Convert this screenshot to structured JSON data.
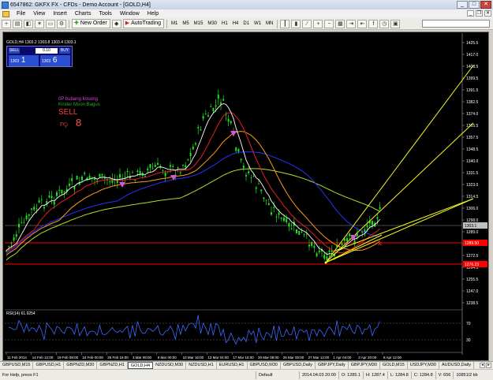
{
  "window": {
    "title": "6547862: GKFX FX - CFDs - Demo Account - [GOLD,H4]"
  },
  "menu": {
    "items": [
      "File",
      "View",
      "Insert",
      "Charts",
      "Tools",
      "Window",
      "Help"
    ]
  },
  "toolbar": {
    "new_order": "New Order",
    "auto_trading": "AutoTrading",
    "timeframes": [
      "M1",
      "M5",
      "M15",
      "M30",
      "H1",
      "H4",
      "D1",
      "W1",
      "MN"
    ]
  },
  "trade_panel": {
    "sell_label": "SELL",
    "buy_label": "BUY",
    "lot": "0.10",
    "sell_price_big": "1",
    "sell_price_small": "1303",
    "buy_price_big": "6",
    "buy_price_small": "1303"
  },
  "chart": {
    "symbol_info": "GOLD,H4  1303.2 1303.8 1303.4 1303.1",
    "label_fp": "0P bubang kosong",
    "label_kinder": "Kinder Moon Bagus",
    "label_sell": "SELL",
    "label_count": "8",
    "rsi_label": "RSI(14) 61.9254",
    "price_ticks": [
      "1425.5",
      "1417.0",
      "1408.5",
      "1399.5",
      "1391.5",
      "1382.5",
      "1374.0",
      "1365.5",
      "1357.5",
      "1348.5",
      "1340.0",
      "1331.5",
      "1323.0",
      "1314.5",
      "1306.0",
      "1298.0",
      "1289.0",
      "1281.0",
      "1272.5",
      "1264.0",
      "1255.5",
      "1247.0",
      "1238.5"
    ],
    "highlight_prices": [
      {
        "text": "1303.1",
        "bg": "#c0c0c0",
        "fg": "#000000"
      },
      {
        "text": "1289.50",
        "bg": "#ff0000",
        "fg": "#ffffff"
      },
      {
        "text": "1276.23",
        "bg": "#ff0000",
        "fg": "#ffffff"
      }
    ],
    "rsi_ticks": [
      "70",
      "30"
    ],
    "time_ticks": [
      "11 Feb 2014",
      "14 Feb 12:00",
      "19 Feb 08:00",
      "24 Feb 00:00",
      "26 Feb 16:00",
      "3 Mar 08:00",
      "6 Mar 00:00",
      "10 Mar 16:00",
      "13 Mar 04:00",
      "17 Mar 16:00",
      "20 Mar 08:00",
      "25 Mar 00:00",
      "27 Mar 12:00",
      "1 Apr 04:00",
      "3 Apr 20:00",
      "8 Apr 12:00"
    ]
  },
  "tabs": [
    "GBPUSD,M15",
    "GBPUSD,H1",
    "GBPNZD,M30",
    "GBPNZD,H1",
    "GOLD,H4",
    "NZDUSD,M30",
    "NZDUSD,H1",
    "EURUSD,H1",
    "GBPUSD,M30",
    "GBPUSD,Daily",
    "GBPJPY,Daily",
    "GBPJPY,M30",
    "GOLD,M15",
    "USDJPY,M30",
    "AUDUSD,Daily"
  ],
  "active_tab": "GOLD,H4",
  "status": {
    "help": "For Help, press F1",
    "profile": "Default",
    "datetime": "2014.04.03 20:00",
    "open": "O: 1285.1",
    "high": "H: 1287.4",
    "low": "L: 1284.8",
    "close": "C: 1284.8",
    "volume": "V: 656",
    "traffic": "10851/2 kb"
  },
  "colors": {
    "candles": "#20e020",
    "ma_white": "#ffffff",
    "ma_red": "#e02020",
    "ma_orange": "#ff9a1a",
    "ma_blue": "#2830ff",
    "ma_yellowgreen": "#a8e02c",
    "trend_yellow": "#f5f520",
    "sr_red": "#ff0000"
  }
}
